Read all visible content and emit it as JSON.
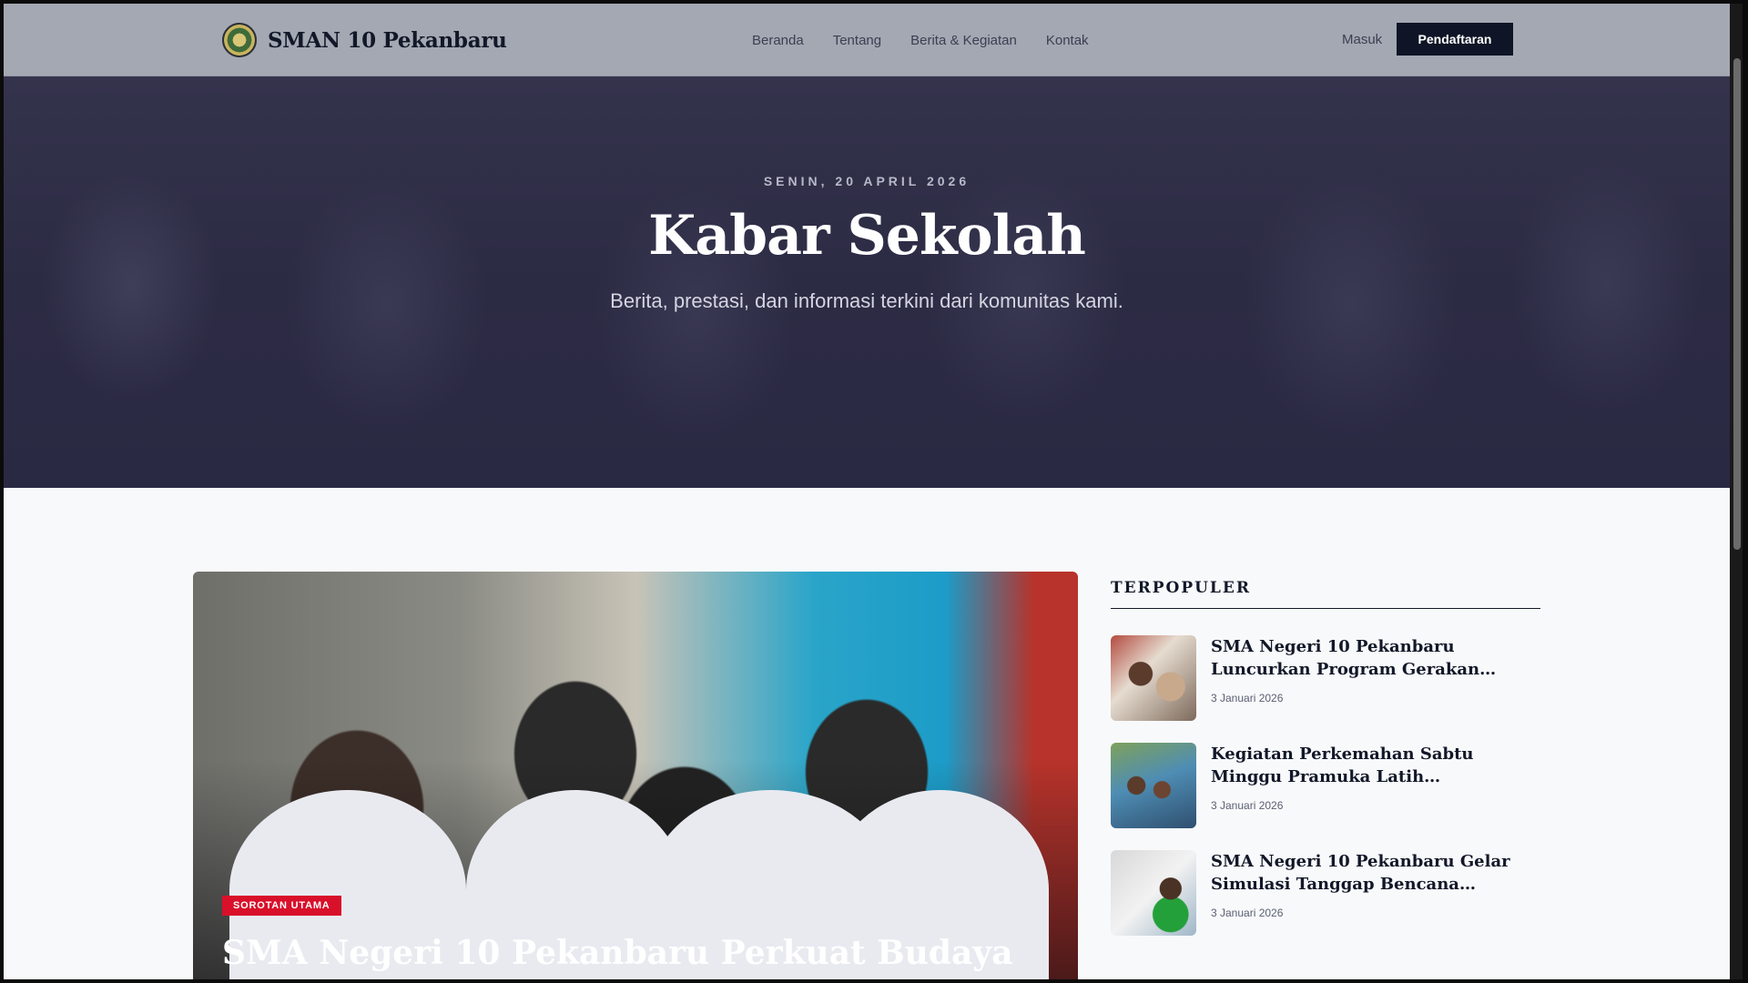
{
  "nav": {
    "brand": "SMAN 10 Pekanbaru",
    "links": [
      "Beranda",
      "Tentang",
      "Berita & Kegiatan",
      "Kontak"
    ],
    "login": "Masuk",
    "register": "Pendaftaran"
  },
  "hero": {
    "date": "SENIN, 20 APRIL 2026",
    "title": "Kabar Sekolah",
    "subtitle": "Berita, prestasi, dan informasi terkini dari komunitas kami."
  },
  "featured": {
    "badge": "SOROTAN UTAMA",
    "title": "SMA Negeri 10 Pekanbaru Perkuat Budaya"
  },
  "popular": {
    "heading": "TERPOPULER",
    "items": [
      {
        "title": "SMA Negeri 10 Pekanbaru Luncurkan Program Gerakan Membaca Pagi",
        "date": "3 Januari 2026"
      },
      {
        "title": "Kegiatan Perkemahan Sabtu Minggu Pramuka Latih Kemandirian Siswa",
        "date": "3 Januari 2026"
      },
      {
        "title": "SMA Negeri 10 Pekanbaru Gelar Simulasi Tanggap Bencana Gempa...",
        "date": "3 Januari 2026"
      }
    ]
  },
  "colors": {
    "accent": "#0f1526",
    "badge": "#d9102a",
    "hero": "#2c2b44"
  }
}
